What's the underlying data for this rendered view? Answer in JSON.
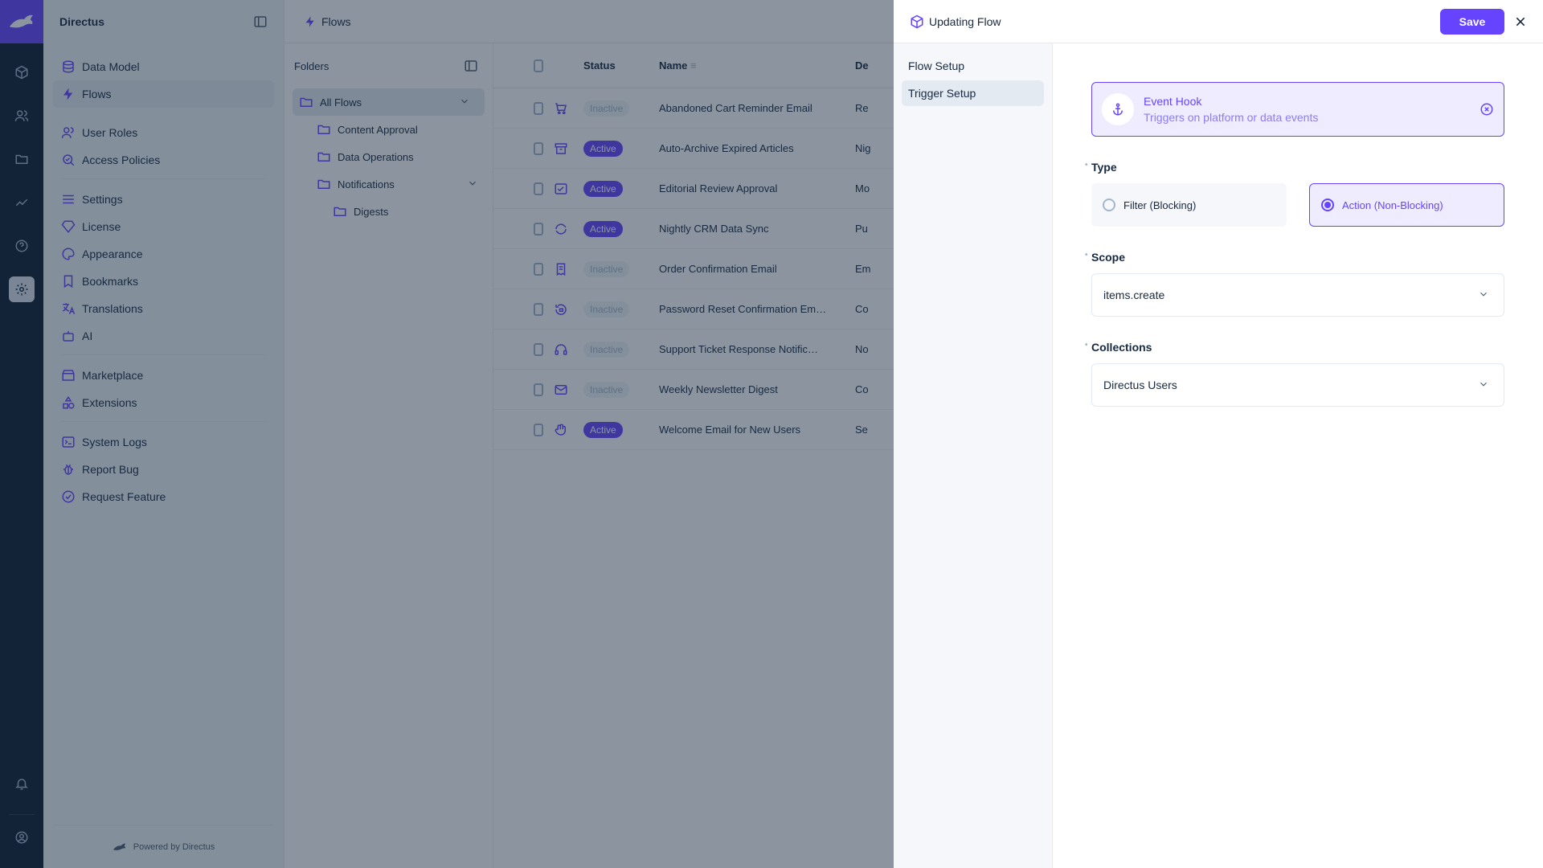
{
  "app": {
    "name": "Directus",
    "powered_by": "Powered by Directus"
  },
  "module_bar": {
    "icons": [
      "content-icon",
      "users-icon",
      "files-icon",
      "insights-icon",
      "help-icon",
      "settings-icon"
    ],
    "bottom_icons": [
      "notifications-icon",
      "user-account-icon"
    ]
  },
  "nav": {
    "items": [
      {
        "label": "Data Model",
        "icon": "database-icon",
        "active": false
      },
      {
        "label": "Flows",
        "icon": "bolt-icon",
        "active": true
      },
      {
        "label": "User Roles",
        "icon": "user-roles-icon",
        "active": false
      },
      {
        "label": "Access Policies",
        "icon": "policy-icon",
        "active": false
      },
      {
        "label": "Settings",
        "icon": "sliders-icon",
        "active": false
      },
      {
        "label": "License",
        "icon": "diamond-icon",
        "active": false
      },
      {
        "label": "Appearance",
        "icon": "palette-icon",
        "active": false
      },
      {
        "label": "Bookmarks",
        "icon": "bookmark-icon",
        "active": false
      },
      {
        "label": "Translations",
        "icon": "translate-icon",
        "active": false
      },
      {
        "label": "AI",
        "icon": "robot-icon",
        "active": false
      },
      {
        "label": "Marketplace",
        "icon": "store-icon",
        "active": false
      },
      {
        "label": "Extensions",
        "icon": "extensions-icon",
        "active": false
      },
      {
        "label": "System Logs",
        "icon": "terminal-icon",
        "active": false
      },
      {
        "label": "Report Bug",
        "icon": "bug-icon",
        "active": false
      },
      {
        "label": "Request Feature",
        "icon": "check-circle-icon",
        "active": false
      }
    ]
  },
  "topbar": {
    "title": "Flows"
  },
  "folders": {
    "title": "Folders",
    "items": [
      {
        "label": "All Flows",
        "level": 0,
        "active": true,
        "expanded": true
      },
      {
        "label": "Content Approval",
        "level": 1
      },
      {
        "label": "Data Operations",
        "level": 1
      },
      {
        "label": "Notifications",
        "level": 1,
        "expanded": true
      },
      {
        "label": "Digests",
        "level": 2
      }
    ]
  },
  "table": {
    "headers": {
      "status": "Status",
      "name": "Name",
      "description": "De"
    },
    "rows": [
      {
        "icon": "cart-icon",
        "status": "Inactive",
        "name": "Abandoned Cart Reminder Email",
        "desc": "Re"
      },
      {
        "icon": "archive-icon",
        "status": "Active",
        "name": "Auto-Archive Expired Articles",
        "desc": "Nig"
      },
      {
        "icon": "approval-icon",
        "status": "Active",
        "name": "Editorial Review Approval",
        "desc": "Mo"
      },
      {
        "icon": "sync-icon",
        "status": "Active",
        "name": "Nightly CRM Data Sync",
        "desc": "Pu"
      },
      {
        "icon": "receipt-icon",
        "status": "Inactive",
        "name": "Order Confirmation Email",
        "desc": "Em"
      },
      {
        "icon": "lock-reset-icon",
        "status": "Inactive",
        "name": "Password Reset Confirmation Em…",
        "desc": "Co"
      },
      {
        "icon": "headset-icon",
        "status": "Inactive",
        "name": "Support Ticket Response Notific…",
        "desc": "No"
      },
      {
        "icon": "mail-icon",
        "status": "Inactive",
        "name": "Weekly Newsletter Digest",
        "desc": "Co"
      },
      {
        "icon": "wave-icon",
        "status": "Active",
        "name": "Welcome Email for New Users",
        "desc": "Se"
      }
    ]
  },
  "drawer": {
    "title": "Updating Flow",
    "save_label": "Save",
    "tabs": [
      {
        "label": "Flow Setup",
        "active": false
      },
      {
        "label": "Trigger Setup",
        "active": true
      }
    ],
    "trigger": {
      "title": "Event Hook",
      "subtitle": "Triggers on platform or data events"
    },
    "type": {
      "label": "Type",
      "options": [
        "Filter (Blocking)",
        "Action (Non-Blocking)"
      ],
      "selected": "Action (Non-Blocking)"
    },
    "scope": {
      "label": "Scope",
      "value": "items.create"
    },
    "collections": {
      "label": "Collections",
      "value": "Directus Users"
    }
  },
  "colors": {
    "accent": "#6644ff",
    "module_bar": "#0e1c2f"
  }
}
